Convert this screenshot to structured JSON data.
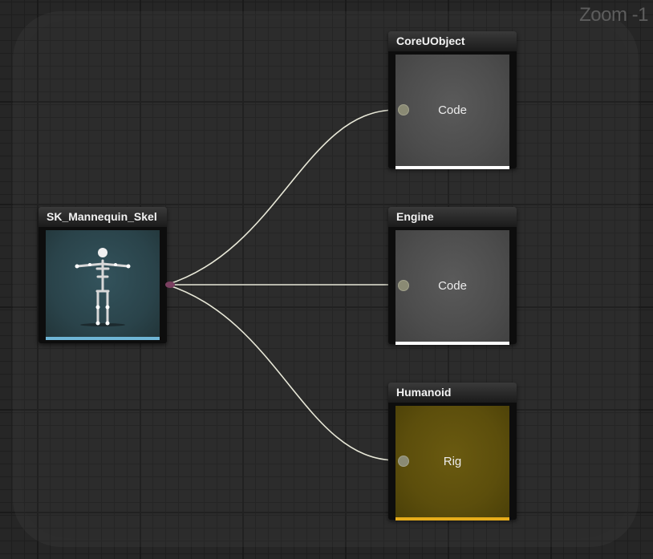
{
  "graph": {
    "zoom_label": "Zoom -1"
  },
  "nodes": {
    "source": {
      "title": "SK_Mannequin_Skel",
      "thumbnail": "skeleton-mannequin-icon",
      "bar_color": "#6fb6d6"
    },
    "coreuobject": {
      "title": "CoreUObject",
      "body": "Code",
      "bar_color": "#ffffff"
    },
    "engine": {
      "title": "Engine",
      "body": "Code",
      "bar_color": "#ffffff"
    },
    "humanoid": {
      "title": "Humanoid",
      "body": "Rig",
      "bar_color": "#e6ad1b"
    }
  },
  "colors": {
    "wire": "#e8e8d8",
    "code_body": "#4d4d4d",
    "rig_body": "#5c4e0c",
    "skel_body": "#2a434a"
  }
}
